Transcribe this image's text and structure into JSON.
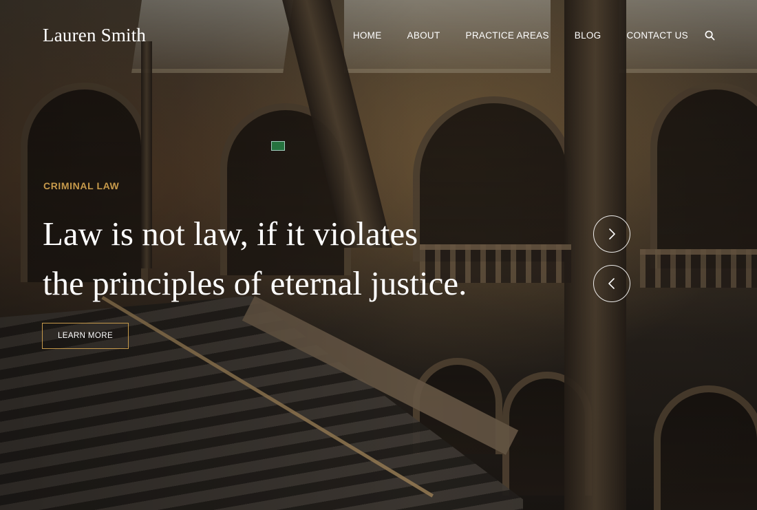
{
  "brand": {
    "name": "Lauren Smith"
  },
  "nav": {
    "items": [
      {
        "label": "HOME"
      },
      {
        "label": "ABOUT"
      },
      {
        "label": "PRACTICE AREAS"
      },
      {
        "label": "BLOG"
      },
      {
        "label": "CONTACT US"
      }
    ],
    "search_icon": "search-icon"
  },
  "hero": {
    "eyebrow": "CRIMINAL LAW",
    "headline_line1": "Law is not law, if it violates",
    "headline_line2": "the principles of eternal justice.",
    "cta_label": "LEARN MORE",
    "next_icon": "chevron-right-icon",
    "prev_icon": "chevron-left-icon"
  },
  "colors": {
    "accent": "#c79a4b",
    "text": "#ffffff"
  }
}
